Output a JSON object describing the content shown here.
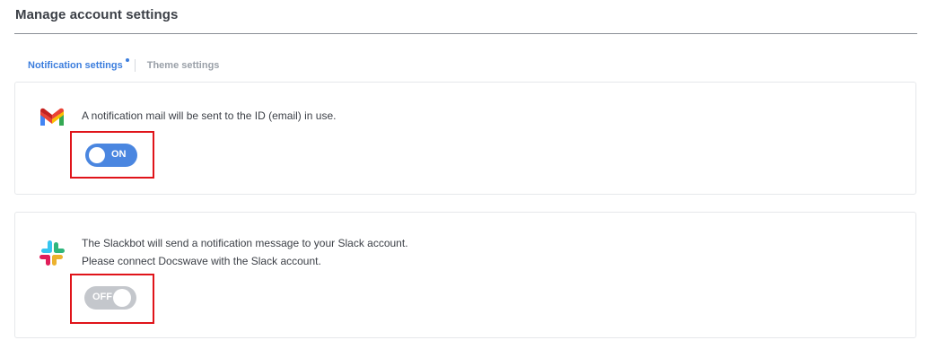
{
  "page": {
    "title": "Manage account settings"
  },
  "tabs": [
    {
      "label": "Notification settings",
      "active": true
    },
    {
      "label": "Theme settings",
      "active": false
    }
  ],
  "gmail": {
    "icon": "gmail-icon",
    "description": "A notification mail will be sent to the ID (email) in use.",
    "toggle": {
      "state": "on",
      "label": "ON"
    }
  },
  "slack": {
    "icon": "slack-icon",
    "description_line1": "The Slackbot will send a notification message to your Slack account.",
    "description_line2": "Please connect Docswave with the Slack account.",
    "toggle": {
      "state": "off",
      "label": "OFF"
    }
  },
  "colors": {
    "accent": "#3b7ddd",
    "toggle_on": "#4a86e0",
    "toggle_off": "#c4c7cc",
    "highlight": "#e0141a"
  }
}
